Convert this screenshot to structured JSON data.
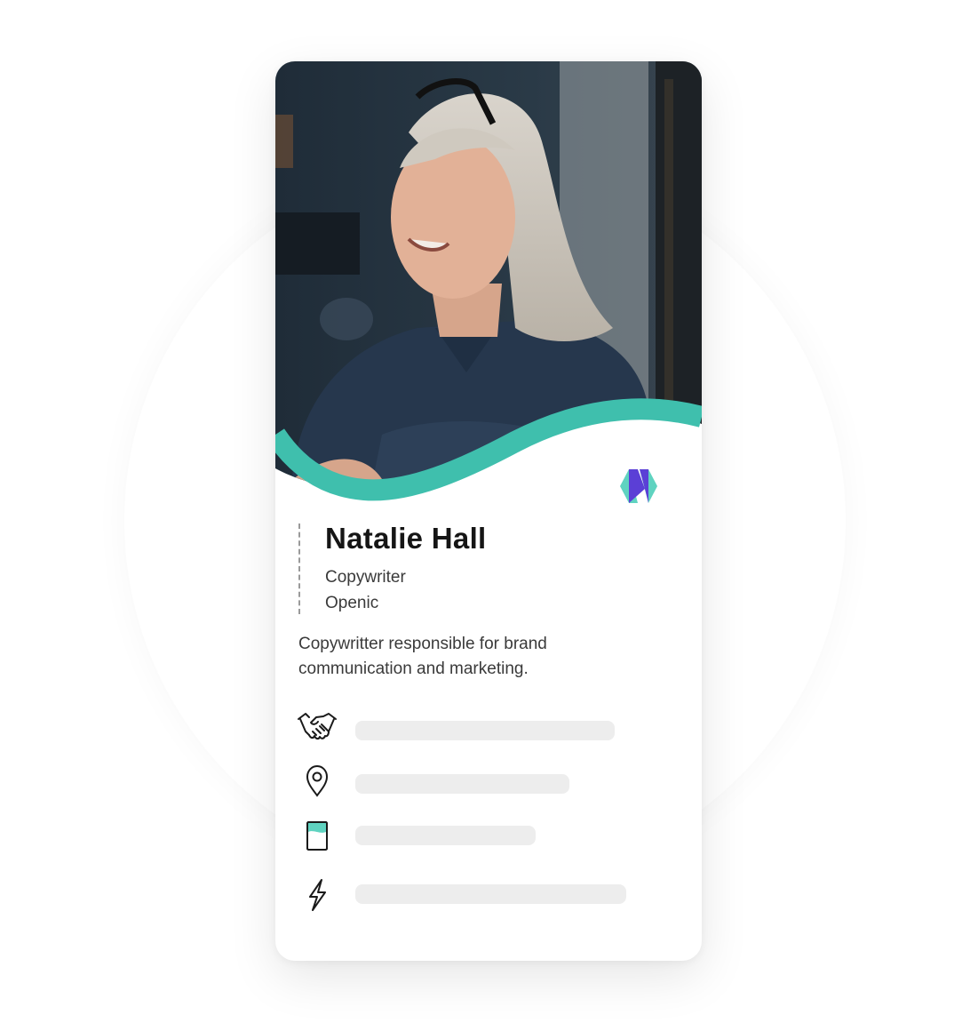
{
  "profile": {
    "name": "Natalie Hall",
    "role": "Copywriter",
    "company": "Openic",
    "description": "Copywritter responsible for brand communication and marketing."
  },
  "info_rows": [
    {
      "icon": "handshake-icon",
      "value": ""
    },
    {
      "icon": "location-pin-icon",
      "value": ""
    },
    {
      "icon": "id-card-icon",
      "value": ""
    },
    {
      "icon": "lightning-icon",
      "value": ""
    }
  ],
  "colors": {
    "accent": "#3fbfad",
    "logo_purple": "#5b3fd6",
    "logo_teal": "#5fd3c0",
    "placeholder_bar": "#ededed"
  }
}
